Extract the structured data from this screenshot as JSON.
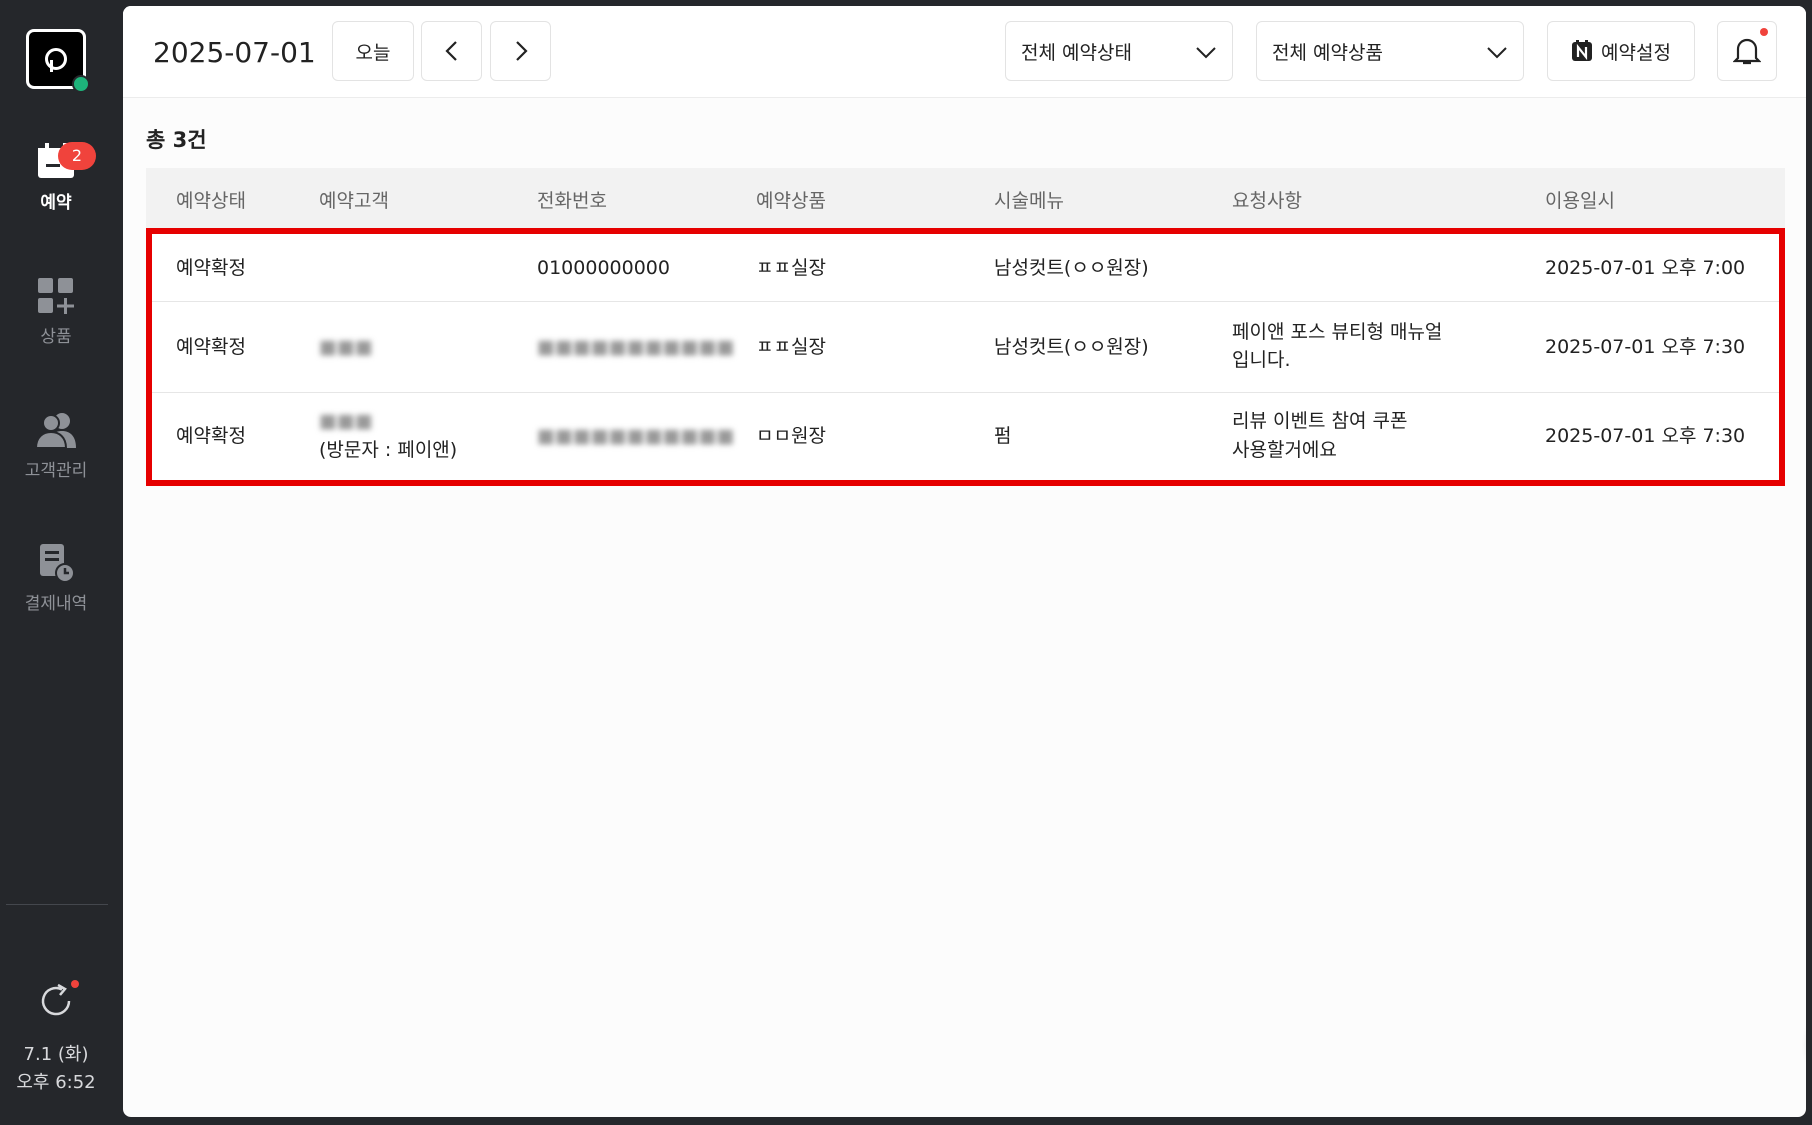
{
  "sidebar": {
    "items": [
      {
        "label": "예약",
        "icon": "calendar-icon",
        "active": true,
        "badge": "2"
      },
      {
        "label": "상품",
        "icon": "grid-plus-icon",
        "active": false
      },
      {
        "label": "고객관리",
        "icon": "users-icon",
        "active": false
      },
      {
        "label": "결제내역",
        "icon": "receipt-clock-icon",
        "active": false
      }
    ],
    "clock_date": "7.1 (화)",
    "clock_time": "오후 6:52"
  },
  "header": {
    "date": "2025-07-01",
    "today_label": "오늘",
    "status_filter": "전체 예약상태",
    "product_filter": "전체 예약상품",
    "settings_label": "예약설정"
  },
  "summary": {
    "total": "총 3건"
  },
  "table": {
    "columns": [
      "예약상태",
      "예약고객",
      "전화번호",
      "예약상품",
      "시술메뉴",
      "요청사항",
      "이용일시"
    ],
    "rows": [
      {
        "status": "예약확정",
        "customer": "",
        "visitor": "",
        "phone": "01000000000",
        "product": "ㅍㅍ실장",
        "menu": "남성컷트(ㅇㅇ원장)",
        "request_1": "",
        "request_2": "",
        "datetime": "2025-07-01 오후 7:00"
      },
      {
        "status": "예약확정",
        "customer": "■■■",
        "visitor": "",
        "phone": "■■■■■■■■■■■",
        "product": "ㅍㅍ실장",
        "menu": "남성컷트(ㅇㅇ원장)",
        "request_1": "페이앤 포스 뷰티형 매뉴얼",
        "request_2": "입니다.",
        "datetime": "2025-07-01 오후 7:30"
      },
      {
        "status": "예약확정",
        "customer": "■■■",
        "visitor": "(방문자 : 페이앤)",
        "phone": "■■■■■■■■■■■",
        "product": "ㅁㅁ원장",
        "menu": "펌",
        "request_1": "리뷰 이벤트 참여 쿠폰",
        "request_2": "사용할거에요",
        "datetime": "2025-07-01 오후 7:30"
      }
    ]
  },
  "colors": {
    "sidebar_bg": "#25272b",
    "badge_red": "#f0433c",
    "highlight_red": "#e60000",
    "fab_green": "#19b373"
  }
}
